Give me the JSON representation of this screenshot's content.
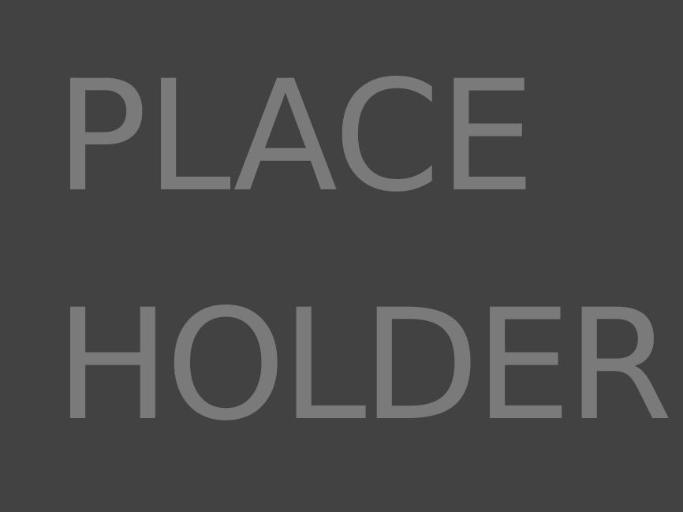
{
  "placeholder": {
    "line_1": "PLACE",
    "line_2": "HOLDER"
  },
  "colors": {
    "background": "#424242",
    "text": "#7a7a7a"
  }
}
